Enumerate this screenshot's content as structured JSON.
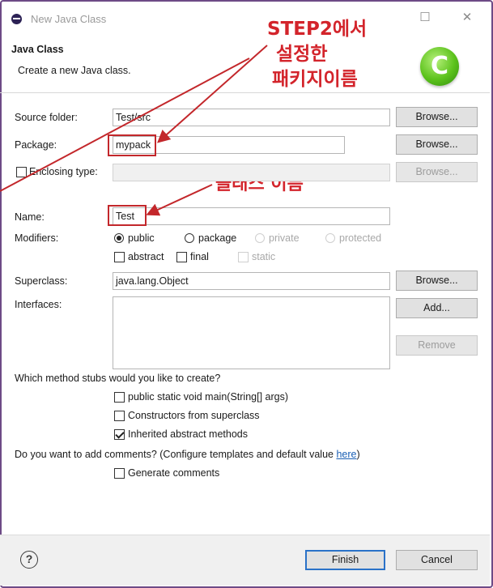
{
  "window": {
    "title": "New Java Class",
    "minimize_glyph": "☐",
    "close_glyph": "✕",
    "app_icon": "eclipse-icon"
  },
  "header": {
    "title": "Java Class",
    "description": "Create a new Java class.",
    "logo_letter": "C",
    "logo_icon": "new-class-wizard-icon"
  },
  "annotations": {
    "step2_line1": "STEP2에서",
    "step2_line2": "설정한",
    "step2_line3": "패키지이름",
    "class_name_note": "클래스 이름",
    "color": "#d3242b"
  },
  "form": {
    "source_folder": {
      "label": "Source folder:",
      "value": "Test/src",
      "button": "Browse..."
    },
    "package": {
      "label": "Package:",
      "value": "mypack",
      "button": "Browse..."
    },
    "enclosing": {
      "label": "Enclosing type:",
      "value": "",
      "checked": false,
      "button": "Browse..."
    },
    "name": {
      "label": "Name:",
      "value": "Test"
    },
    "modifiers": {
      "label": "Modifiers:",
      "public": "public",
      "package": "package",
      "private": "private",
      "protected": "protected",
      "abstract": "abstract",
      "final": "final",
      "static": "static",
      "selected": "public"
    },
    "superclass": {
      "label": "Superclass:",
      "value": "java.lang.Object",
      "button": "Browse..."
    },
    "interfaces": {
      "label": "Interfaces:",
      "add_button": "Add...",
      "remove_button": "Remove"
    },
    "stubs": {
      "question": "Which method stubs would you like to create?",
      "main": {
        "label": "public static void main(String[] args)",
        "checked": false
      },
      "constructors": {
        "label": "Constructors from superclass",
        "checked": false
      },
      "inherited": {
        "label": "Inherited abstract methods",
        "checked": true
      }
    },
    "comments": {
      "question_prefix": "Do you want to add comments? (Configure templates and default value ",
      "link": "here",
      "question_suffix": ")",
      "generate": {
        "label": "Generate comments",
        "checked": false
      }
    }
  },
  "footer": {
    "help_glyph": "?",
    "finish": "Finish",
    "cancel": "Cancel"
  }
}
